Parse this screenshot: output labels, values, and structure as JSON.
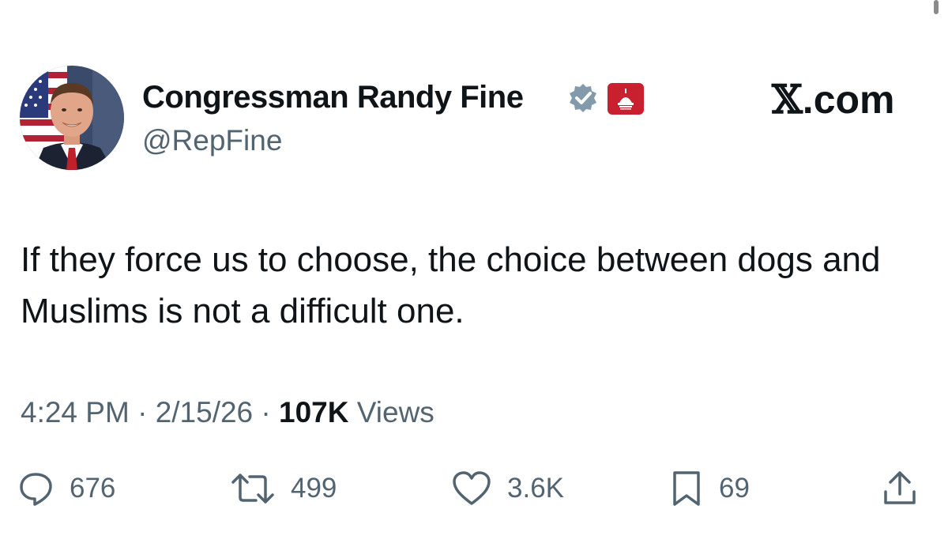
{
  "author": {
    "display_name": "Congressman Randy Fine",
    "handle": "@RepFine",
    "verified_icon": "verified-badge-icon",
    "affiliate_icon": "house-gop-affiliate-icon"
  },
  "watermark": {
    "x_glyph": "𝕏",
    "suffix": ".com"
  },
  "tweet": {
    "text": "If they force us to choose, the choice between dogs and Muslims is not a difficult one."
  },
  "meta": {
    "time": "4:24 PM",
    "separator": " · ",
    "date": "2/15/26",
    "views_count": "107K",
    "views_label": " Views"
  },
  "actions": {
    "replies": "676",
    "reposts": "499",
    "likes": "3.6K",
    "bookmarks": "69"
  },
  "colors": {
    "text_primary": "#0f1419",
    "text_secondary": "#536471",
    "verified_badge": "#829aab",
    "affiliate_badge": "#c8202f"
  }
}
